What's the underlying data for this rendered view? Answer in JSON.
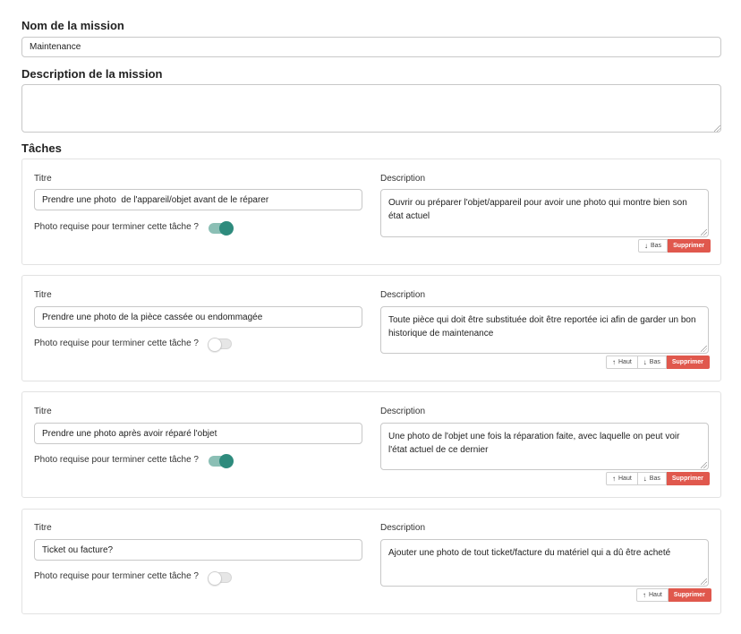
{
  "mission": {
    "name_label": "Nom de la mission",
    "name_value": "Maintenance",
    "description_label": "Description de la mission",
    "description_value": ""
  },
  "tasks_label": "Tâches",
  "task_common": {
    "title_label": "Titre",
    "description_label": "Description",
    "photo_required_label": "Photo requise pour terminer cette tâche ?",
    "up_label": "Haut",
    "down_label": "Bas",
    "delete_label": "Supprimer"
  },
  "tasks": [
    {
      "title": "Prendre une photo  de l'appareil/objet avant de le réparer",
      "description": "Ouvrir ou préparer l'objet/appareil pour avoir une photo qui montre bien son état actuel",
      "photo_required": true
    },
    {
      "title": "Prendre une photo de la pièce cassée ou endommagée",
      "description": "Toute pièce qui doit être substituée doit être reportée ici afin de garder un bon historique de maintenance",
      "photo_required": false
    },
    {
      "title": "Prendre une photo après avoir réparé l'objet",
      "description": "Une photo de l'objet une fois la réparation faite, avec laquelle on peut voir l'état actuel de ce dernier",
      "photo_required": true
    },
    {
      "title": "Ticket ou facture?",
      "description": "Ajouter une photo de tout ticket/facture du matériel qui a dû être acheté",
      "photo_required": false
    }
  ],
  "colors": {
    "toggle_on": "#2e8b7d",
    "delete_button": "#e0584d"
  }
}
